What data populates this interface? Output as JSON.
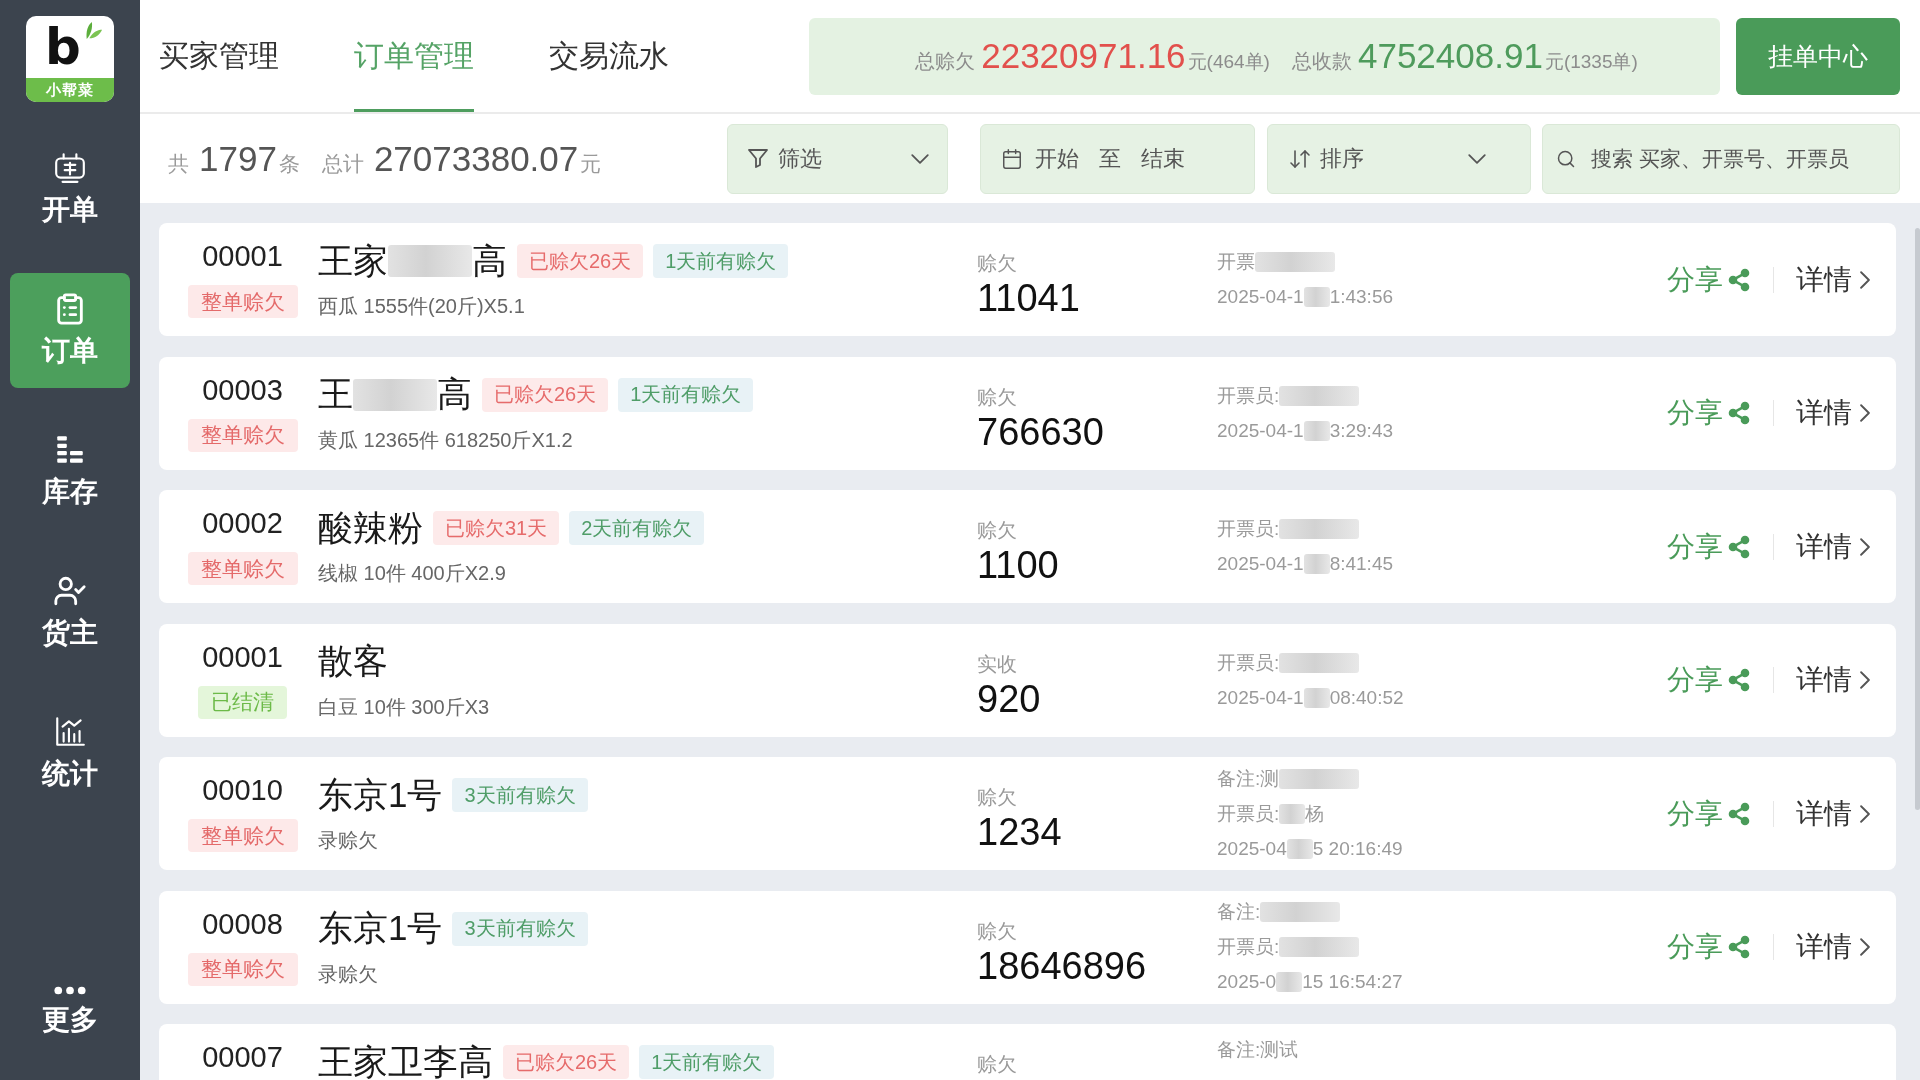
{
  "sidebar": {
    "logo": {
      "letter": "b",
      "text": "小帮菜"
    },
    "items": [
      {
        "label": "开单",
        "selected": false
      },
      {
        "label": "订单",
        "selected": true
      },
      {
        "label": "库存",
        "selected": false
      },
      {
        "label": "货主",
        "selected": false
      },
      {
        "label": "统计",
        "selected": false
      },
      {
        "label": "更多",
        "selected": false
      }
    ]
  },
  "tabs": [
    {
      "label": "买家管理",
      "selected": false
    },
    {
      "label": "订单管理",
      "selected": true
    },
    {
      "label": "交易流水",
      "selected": false
    }
  ],
  "summary": [
    {
      "kind": "debt",
      "label": "总赊欠",
      "amount": "22320971.16",
      "unit": "元(464单)"
    },
    {
      "kind": "paid",
      "label": "总收款",
      "amount": "4752408.91",
      "unit": "元(1335单)"
    }
  ],
  "pending_button": "挂单中心",
  "stats": {
    "count_prefix": "共",
    "count": "1797",
    "count_unit": "条",
    "total_label": "总计",
    "total": "27073380.07",
    "total_unit": "元"
  },
  "toolbar": {
    "filter": {
      "label": "筛选"
    },
    "date_range": {
      "start": "开始",
      "separator": "至",
      "end": "结束"
    },
    "sort": {
      "label": "排序"
    },
    "search": {
      "placeholder": "搜索 买家、开票号、开票员"
    }
  },
  "orders": [
    {
      "number": "00001",
      "status": {
        "kind": "debt",
        "label": "整单赊欠"
      },
      "name": [
        {
          "kind": "text",
          "text": "王家"
        },
        {
          "kind": "blur"
        },
        {
          "kind": "text",
          "text": "高"
        }
      ],
      "tags": [
        {
          "kind": "overdue",
          "label": "已赊欠26天"
        },
        {
          "kind": "recent",
          "label": "1天前有赊欠"
        }
      ],
      "goods": "西瓜 1555件(20斤)X5.1",
      "amount_label": "赊欠",
      "amount": "11041",
      "info": [
        [
          {
            "kind": "text",
            "text": "开票"
          },
          {
            "kind": "blur"
          }
        ],
        [
          {
            "kind": "text",
            "text": "2025-04-1"
          },
          {
            "kind": "blur"
          },
          {
            "kind": "text",
            "text": "1:43:56"
          }
        ]
      ],
      "share": "分享",
      "details": "详情",
      "truncated": false
    },
    {
      "number": "00003",
      "status": {
        "kind": "debt",
        "label": "整单赊欠"
      },
      "name": [
        {
          "kind": "text",
          "text": "王"
        },
        {
          "kind": "blur"
        },
        {
          "kind": "text",
          "text": "高"
        }
      ],
      "tags": [
        {
          "kind": "overdue",
          "label": "已赊欠26天"
        },
        {
          "kind": "recent",
          "label": "1天前有赊欠"
        }
      ],
      "goods": "黄瓜 12365件 618250斤X1.2",
      "amount_label": "赊欠",
      "amount": "766630",
      "info": [
        [
          {
            "kind": "text",
            "text": "开票员:"
          },
          {
            "kind": "blur"
          }
        ],
        [
          {
            "kind": "text",
            "text": "2025-04-1"
          },
          {
            "kind": "blur"
          },
          {
            "kind": "text",
            "text": "3:29:43"
          }
        ]
      ],
      "share": "分享",
      "details": "详情",
      "truncated": false
    },
    {
      "number": "00002",
      "status": {
        "kind": "debt",
        "label": "整单赊欠"
      },
      "name": [
        {
          "kind": "text",
          "text": "酸辣粉"
        }
      ],
      "tags": [
        {
          "kind": "overdue",
          "label": "已赊欠31天"
        },
        {
          "kind": "recent",
          "label": "2天前有赊欠"
        }
      ],
      "goods": "线椒 10件 400斤X2.9",
      "amount_label": "赊欠",
      "amount": "1100",
      "info": [
        [
          {
            "kind": "text",
            "text": "开票员:"
          },
          {
            "kind": "blur"
          }
        ],
        [
          {
            "kind": "text",
            "text": "2025-04-1"
          },
          {
            "kind": "blur"
          },
          {
            "kind": "text",
            "text": "8:41:45"
          }
        ]
      ],
      "share": "分享",
      "details": "详情",
      "truncated": false
    },
    {
      "number": "00001",
      "status": {
        "kind": "settled",
        "label": "已结清"
      },
      "name": [
        {
          "kind": "text",
          "text": "散客"
        }
      ],
      "goods": "白豆 10件 300斤X3",
      "amount_label": "实收",
      "amount": "920",
      "info": [
        [
          {
            "kind": "text",
            "text": "开票员:"
          },
          {
            "kind": "blur"
          }
        ],
        [
          {
            "kind": "text",
            "text": "2025-04-1"
          },
          {
            "kind": "blur"
          },
          {
            "kind": "text",
            "text": "08:40:52"
          }
        ]
      ],
      "share": "分享",
      "details": "详情",
      "truncated": false
    },
    {
      "number": "00010",
      "status": {
        "kind": "debt",
        "label": "整单赊欠"
      },
      "name": [
        {
          "kind": "text",
          "text": "东京1号"
        }
      ],
      "tags": [
        {
          "kind": "recent",
          "label": "3天前有赊欠"
        }
      ],
      "goods": "录赊欠",
      "amount_label": "赊欠",
      "amount": "1234",
      "info": [
        [
          {
            "kind": "text",
            "text": "备注:测"
          },
          {
            "kind": "blur"
          }
        ],
        [
          {
            "kind": "text",
            "text": "开票员:"
          },
          {
            "kind": "blur"
          },
          {
            "kind": "text",
            "text": "杨"
          }
        ],
        [
          {
            "kind": "text",
            "text": "2025-04"
          },
          {
            "kind": "blur"
          },
          {
            "kind": "text",
            "text": "5 20:16:49"
          }
        ]
      ],
      "share": "分享",
      "details": "详情",
      "truncated": false
    },
    {
      "number": "00008",
      "status": {
        "kind": "debt",
        "label": "整单赊欠"
      },
      "name": [
        {
          "kind": "text",
          "text": "东京1号"
        }
      ],
      "tags": [
        {
          "kind": "recent",
          "label": "3天前有赊欠"
        }
      ],
      "goods": "录赊欠",
      "amount_label": "赊欠",
      "amount": "18646896",
      "info": [
        [
          {
            "kind": "text",
            "text": "备注:"
          },
          {
            "kind": "blur"
          }
        ],
        [
          {
            "kind": "text",
            "text": "开票员:"
          },
          {
            "kind": "blur"
          }
        ],
        [
          {
            "kind": "text",
            "text": "2025-0"
          },
          {
            "kind": "blur"
          },
          {
            "kind": "text",
            "text": "15 16:54:27"
          }
        ]
      ],
      "share": "分享",
      "details": "详情",
      "truncated": false
    },
    {
      "number": "00007",
      "name": [
        {
          "kind": "text",
          "text": "王家卫李高"
        }
      ],
      "tags": [
        {
          "kind": "overdue",
          "label": "已赊欠26天"
        },
        {
          "kind": "recent",
          "label": "1天前有赊欠"
        }
      ],
      "amount_label": "赊欠",
      "info": [
        [
          {
            "kind": "text",
            "text": "备注:测试"
          }
        ]
      ],
      "truncated": true
    }
  ]
}
